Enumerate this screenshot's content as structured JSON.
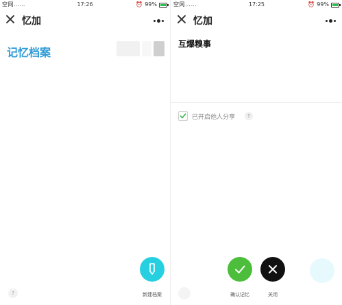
{
  "left": {
    "status": {
      "signal": "空网……",
      "time": "17:26",
      "battery": "99%"
    },
    "title": "忆加",
    "archive_title": "记忆档案",
    "new_button_label": "新建档案",
    "help": "?"
  },
  "right": {
    "status": {
      "signal": "空网……",
      "time": "17:25",
      "battery": "99%"
    },
    "title": "忆加",
    "note_title": "互爆糗事",
    "share_label": "已开启他人分享",
    "share_checked": true,
    "help": "?",
    "confirm_label": "确认记忆",
    "close_label": "关闭"
  },
  "colors": {
    "accent_blue": "#2e9bd6",
    "cyan": "#26d0e0",
    "green": "#4dbd3c",
    "black": "#111111"
  },
  "icons": [
    "close-icon",
    "more-icon",
    "pen-icon",
    "check-icon",
    "close-icon",
    "help-icon",
    "alarm-icon",
    "battery-icon"
  ]
}
